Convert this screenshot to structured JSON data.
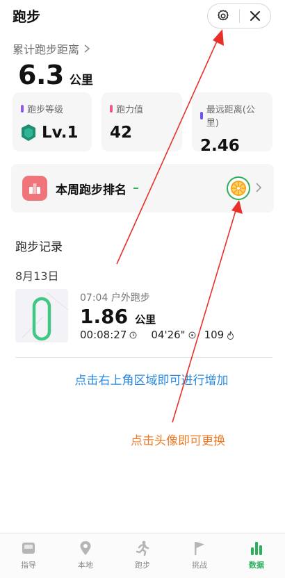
{
  "header": {
    "title": "跑步"
  },
  "summary": {
    "label": "累计跑步距离",
    "value": "6.3",
    "unit": "公里"
  },
  "stats": [
    {
      "label": "跑步等级",
      "value": "Lv.1",
      "dot_color": "#8e5bf0"
    },
    {
      "label": "跑力值",
      "value": "42",
      "dot_color": "#f05a7e"
    },
    {
      "label": "最远距离(公里)",
      "value": "2.46",
      "dot_color": "#6a55f0"
    }
  ],
  "ranking": {
    "title": "本周跑步排名"
  },
  "records": {
    "section_title": "跑步记录",
    "date": "8月13日",
    "items": [
      {
        "time": "07:04",
        "type": "户外跑步",
        "distance": "1.86",
        "unit": "公里",
        "duration": "00:08:27",
        "pace": "04'26\"",
        "steps": "109"
      }
    ]
  },
  "annotations": {
    "top_right": "点击右上角区域即可进行增加",
    "avatar": "点击头像即可更换"
  },
  "tabs": [
    {
      "label": "指导",
      "icon": "guide-icon",
      "active": false
    },
    {
      "label": "本地",
      "icon": "location-pin-icon",
      "active": false
    },
    {
      "label": "跑步",
      "icon": "runner-icon",
      "active": false
    },
    {
      "label": "挑战",
      "icon": "flag-icon",
      "active": false
    },
    {
      "label": "数据",
      "icon": "bar-chart-icon",
      "active": true
    }
  ],
  "colors": {
    "accent_green": "#2bb05c",
    "note_blue": "#2a8ae0",
    "note_orange": "#ee7a26",
    "arrow_red": "#e8302a"
  }
}
